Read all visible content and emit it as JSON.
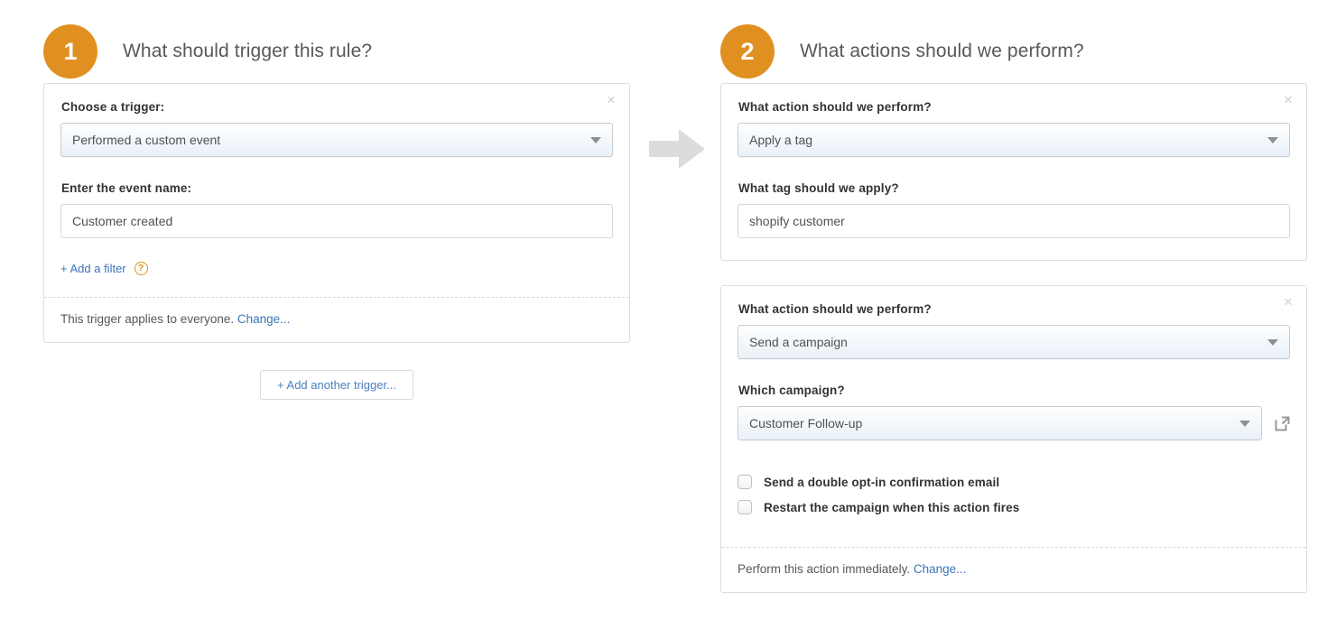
{
  "triggers": {
    "step_number": "1",
    "step_title": "What should trigger this rule?",
    "panel": {
      "close_label": "×",
      "trigger_label": "Choose a trigger:",
      "trigger_value": "Performed a custom event",
      "event_name_label": "Enter the event name:",
      "event_name_value": "Customer created",
      "add_filter_label": "+ Add a filter",
      "help_glyph": "?",
      "footer_text": "This trigger applies to everyone.",
      "footer_link": "Change..."
    },
    "add_another_label": "+ Add another trigger..."
  },
  "actions": {
    "step_number": "2",
    "step_title": "What actions should we perform?",
    "panels": [
      {
        "close_label": "×",
        "action_label": "What action should we perform?",
        "action_value": "Apply a tag",
        "detail_label": "What tag should we apply?",
        "detail_value": "shopify customer"
      },
      {
        "close_label": "×",
        "action_label": "What action should we perform?",
        "action_value": "Send a campaign",
        "campaign_label": "Which campaign?",
        "campaign_value": "Customer Follow-up",
        "checkboxes": [
          {
            "label": "Send a double opt-in confirmation email",
            "checked": false
          },
          {
            "label": "Restart the campaign when this action fires",
            "checked": false
          }
        ],
        "footer_text": "Perform this action immediately.",
        "footer_link": "Change..."
      }
    ]
  },
  "colors": {
    "accent_orange": "#e09021",
    "link_blue": "#3c74b9",
    "arrow_grey": "#dcdcdc",
    "panel_border": "#dedede"
  }
}
